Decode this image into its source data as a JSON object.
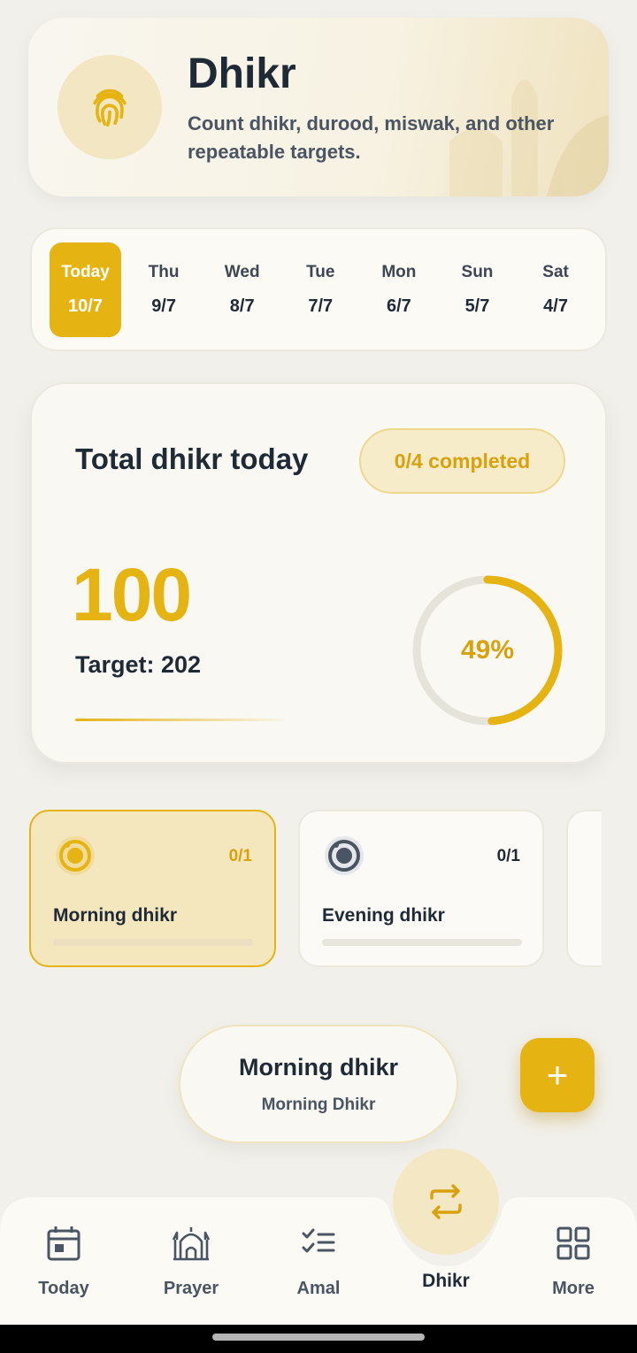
{
  "header": {
    "title": "Dhikr",
    "subtitle": "Count dhikr, durood, miswak, and other repeatable targets.",
    "icon": "fingerprint-icon"
  },
  "days": [
    {
      "name": "Today",
      "date": "10/7",
      "active": true
    },
    {
      "name": "Thu",
      "date": "9/7"
    },
    {
      "name": "Wed",
      "date": "8/7"
    },
    {
      "name": "Tue",
      "date": "7/7"
    },
    {
      "name": "Mon",
      "date": "6/7"
    },
    {
      "name": "Sun",
      "date": "5/7"
    },
    {
      "name": "Sat",
      "date": "4/7"
    }
  ],
  "summary": {
    "title": "Total dhikr today",
    "completed_badge": "0/4 completed",
    "count": "100",
    "target": "Target: 202",
    "percent_label": "49%",
    "percent": 0.49
  },
  "habits": [
    {
      "name": "Morning dhikr",
      "count": "0/1",
      "active": true,
      "progress": 0
    },
    {
      "name": "Evening dhikr",
      "count": "0/1",
      "active": false,
      "progress": 0
    }
  ],
  "pill": {
    "title": "Morning dhikr",
    "subtitle": "Morning Dhikr"
  },
  "fab": {
    "label": "+"
  },
  "nav": {
    "today": "Today",
    "prayer": "Prayer",
    "amal": "Amal",
    "dhikr": "Dhikr",
    "more": "More"
  },
  "colors": {
    "accent": "#e5b312",
    "text": "#1f2a37",
    "muted": "#4a5563",
    "background": "#f1f0eb"
  }
}
